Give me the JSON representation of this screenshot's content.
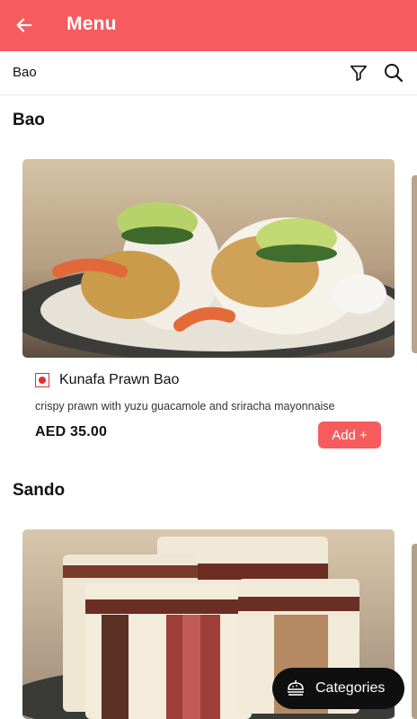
{
  "appbar": {
    "title": "Menu"
  },
  "subbar": {
    "current_category": "Bao"
  },
  "sections": [
    {
      "title": "Bao",
      "item": {
        "name": "Kunafa Prawn Bao",
        "description": "crispy prawn with yuzu guacamole and sriracha mayonnaise",
        "price": "AED 35.00",
        "add_label": "Add +"
      }
    },
    {
      "title": "Sando"
    }
  ],
  "categories_button": {
    "label": "Categories"
  },
  "colors": {
    "accent": "#f65b5e",
    "veg_mark": "#e03030",
    "fab_bg": "#0f0f0f"
  },
  "icons": [
    "back-arrow-icon",
    "filter-icon",
    "search-icon",
    "food-menu-icon"
  ]
}
